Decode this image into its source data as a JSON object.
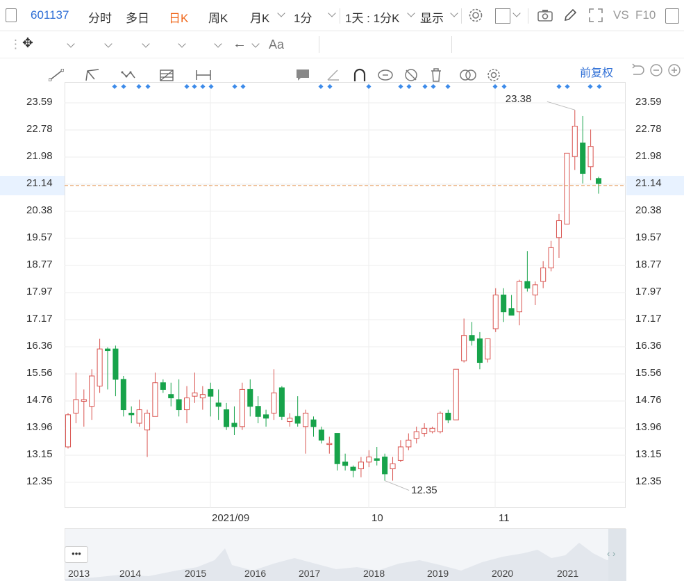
{
  "toolbar": {
    "code": "601137",
    "periods": [
      "分时",
      "多日",
      "日K",
      "周K",
      "月K",
      "1分"
    ],
    "active_period": "日K",
    "range_label": "1天 : 1分K",
    "display_label": "显示",
    "vs_label": "VS",
    "f10_label": "F10"
  },
  "chart_header": {
    "fq_label": "前复权"
  },
  "price_axis": {
    "ticks": [
      "23.59",
      "22.78",
      "21.98",
      "21.14",
      "20.38",
      "19.57",
      "18.77",
      "17.97",
      "17.17",
      "16.36",
      "15.56",
      "14.76",
      "13.96",
      "13.15",
      "12.35"
    ],
    "current": "21.14"
  },
  "x_axis": {
    "labels": [
      "2021/09",
      "10",
      "11"
    ]
  },
  "annotations": {
    "high": "23.38",
    "low": "12.35"
  },
  "navigator": {
    "more_label": "•••",
    "years": [
      "2013",
      "2014",
      "2015",
      "2016",
      "2017",
      "2018",
      "2019",
      "2020",
      "2021"
    ]
  },
  "colors": {
    "up": "#d9534f",
    "down": "#17a34a",
    "accent": "#2f6fd6",
    "active": "#f06a1f",
    "dash": "#e08a3c"
  },
  "chart_data": {
    "type": "candlestick",
    "ylim": [
      11.9,
      24.1
    ],
    "candles": [
      {
        "o": 13.4,
        "c": 14.35,
        "h": 14.4,
        "l": 13.35
      },
      {
        "o": 14.4,
        "c": 14.8,
        "h": 15.6,
        "l": 14.1
      },
      {
        "o": 14.75,
        "c": 14.8,
        "h": 15.1,
        "l": 14.0
      },
      {
        "o": 14.6,
        "c": 15.5,
        "h": 15.7,
        "l": 14.2
      },
      {
        "o": 15.2,
        "c": 16.3,
        "h": 16.6,
        "l": 15.0
      },
      {
        "o": 16.3,
        "c": 16.25,
        "h": 16.35,
        "l": 15.1
      },
      {
        "o": 16.3,
        "c": 15.4,
        "h": 16.4,
        "l": 14.9
      },
      {
        "o": 15.4,
        "c": 14.5,
        "h": 15.5,
        "l": 14.3
      },
      {
        "o": 14.4,
        "c": 14.35,
        "h": 14.6,
        "l": 14.1
      },
      {
        "o": 14.1,
        "c": 14.5,
        "h": 14.8,
        "l": 14.0
      },
      {
        "o": 13.9,
        "c": 14.4,
        "h": 14.5,
        "l": 13.1
      },
      {
        "o": 14.3,
        "c": 15.3,
        "h": 15.6,
        "l": 14.3
      },
      {
        "o": 15.3,
        "c": 15.1,
        "h": 15.4,
        "l": 15.0
      },
      {
        "o": 14.95,
        "c": 14.85,
        "h": 15.3,
        "l": 14.6
      },
      {
        "o": 14.8,
        "c": 14.5,
        "h": 15.4,
        "l": 14.3
      },
      {
        "o": 14.5,
        "c": 14.85,
        "h": 15.2,
        "l": 14.1
      },
      {
        "o": 14.9,
        "c": 15.0,
        "h": 15.6,
        "l": 14.7
      },
      {
        "o": 14.85,
        "c": 14.95,
        "h": 15.2,
        "l": 14.5
      },
      {
        "o": 15.1,
        "c": 14.9,
        "h": 15.3,
        "l": 14.3
      },
      {
        "o": 14.7,
        "c": 14.6,
        "h": 15.1,
        "l": 14.2
      },
      {
        "o": 14.5,
        "c": 14.0,
        "h": 14.7,
        "l": 13.9
      },
      {
        "o": 14.1,
        "c": 14.0,
        "h": 14.6,
        "l": 13.75
      },
      {
        "o": 14.0,
        "c": 15.1,
        "h": 15.3,
        "l": 13.9
      },
      {
        "o": 15.1,
        "c": 14.6,
        "h": 15.4,
        "l": 14.3
      },
      {
        "o": 14.6,
        "c": 14.3,
        "h": 14.9,
        "l": 14.1
      },
      {
        "o": 14.35,
        "c": 14.25,
        "h": 14.5,
        "l": 14.0
      },
      {
        "o": 14.4,
        "c": 15.0,
        "h": 15.7,
        "l": 14.2
      },
      {
        "o": 15.15,
        "c": 14.3,
        "h": 15.2,
        "l": 14.2
      },
      {
        "o": 14.15,
        "c": 14.25,
        "h": 14.4,
        "l": 14.0
      },
      {
        "o": 14.3,
        "c": 14.1,
        "h": 14.9,
        "l": 14.0
      },
      {
        "o": 14.0,
        "c": 14.4,
        "h": 14.5,
        "l": 13.2
      },
      {
        "o": 14.2,
        "c": 14.0,
        "h": 14.3,
        "l": 13.7
      },
      {
        "o": 13.9,
        "c": 13.6,
        "h": 14.0,
        "l": 13.5
      },
      {
        "o": 13.5,
        "c": 13.5,
        "h": 13.7,
        "l": 13.2
      },
      {
        "o": 13.8,
        "c": 12.9,
        "h": 13.8,
        "l": 12.7
      },
      {
        "o": 12.95,
        "c": 12.85,
        "h": 13.2,
        "l": 12.7
      },
      {
        "o": 12.8,
        "c": 12.7,
        "h": 12.85,
        "l": 12.5
      },
      {
        "o": 12.75,
        "c": 12.95,
        "h": 13.1,
        "l": 12.5
      },
      {
        "o": 12.95,
        "c": 13.1,
        "h": 13.3,
        "l": 12.8
      },
      {
        "o": 13.05,
        "c": 13.0,
        "h": 13.4,
        "l": 12.85
      },
      {
        "o": 13.1,
        "c": 12.6,
        "h": 13.2,
        "l": 12.4
      },
      {
        "o": 12.75,
        "c": 12.9,
        "h": 13.1,
        "l": 12.4
      },
      {
        "o": 13.0,
        "c": 13.4,
        "h": 13.6,
        "l": 12.95
      },
      {
        "o": 13.4,
        "c": 13.6,
        "h": 13.8,
        "l": 13.3
      },
      {
        "o": 13.65,
        "c": 13.85,
        "h": 14.0,
        "l": 13.5
      },
      {
        "o": 13.8,
        "c": 13.95,
        "h": 14.1,
        "l": 13.7
      },
      {
        "o": 13.85,
        "c": 13.95,
        "h": 14.0,
        "l": 13.8
      },
      {
        "o": 13.85,
        "c": 14.4,
        "h": 14.45,
        "l": 13.8
      },
      {
        "o": 14.4,
        "c": 14.2,
        "h": 14.5,
        "l": 14.1
      },
      {
        "o": 14.2,
        "c": 15.7,
        "h": 15.7,
        "l": 14.2
      },
      {
        "o": 15.95,
        "c": 16.7,
        "h": 17.2,
        "l": 15.9
      },
      {
        "o": 16.7,
        "c": 16.55,
        "h": 17.1,
        "l": 16.4
      },
      {
        "o": 16.6,
        "c": 15.9,
        "h": 16.8,
        "l": 15.7
      },
      {
        "o": 16.0,
        "c": 16.6,
        "h": 16.6,
        "l": 15.9
      },
      {
        "o": 16.9,
        "c": 17.9,
        "h": 18.1,
        "l": 16.8
      },
      {
        "o": 17.9,
        "c": 17.4,
        "h": 18.1,
        "l": 17.1
      },
      {
        "o": 17.5,
        "c": 17.3,
        "h": 17.9,
        "l": 17.3
      },
      {
        "o": 17.4,
        "c": 18.3,
        "h": 18.35,
        "l": 17.0
      },
      {
        "o": 18.3,
        "c": 18.1,
        "h": 19.2,
        "l": 18.0
      },
      {
        "o": 17.9,
        "c": 18.2,
        "h": 18.3,
        "l": 17.6
      },
      {
        "o": 18.3,
        "c": 18.7,
        "h": 18.9,
        "l": 18.1
      },
      {
        "o": 18.7,
        "c": 19.3,
        "h": 19.5,
        "l": 18.6
      },
      {
        "o": 19.6,
        "c": 20.1,
        "h": 20.3,
        "l": 19.0
      },
      {
        "o": 20.0,
        "c": 22.1,
        "h": 22.1,
        "l": 20.0
      },
      {
        "o": 22.0,
        "c": 22.9,
        "h": 23.38,
        "l": 21.6
      },
      {
        "o": 22.4,
        "c": 21.5,
        "h": 23.2,
        "l": 21.2
      },
      {
        "o": 21.7,
        "c": 22.3,
        "h": 22.8,
        "l": 21.3
      },
      {
        "o": 21.35,
        "c": 21.2,
        "h": 21.4,
        "l": 20.9
      }
    ]
  }
}
